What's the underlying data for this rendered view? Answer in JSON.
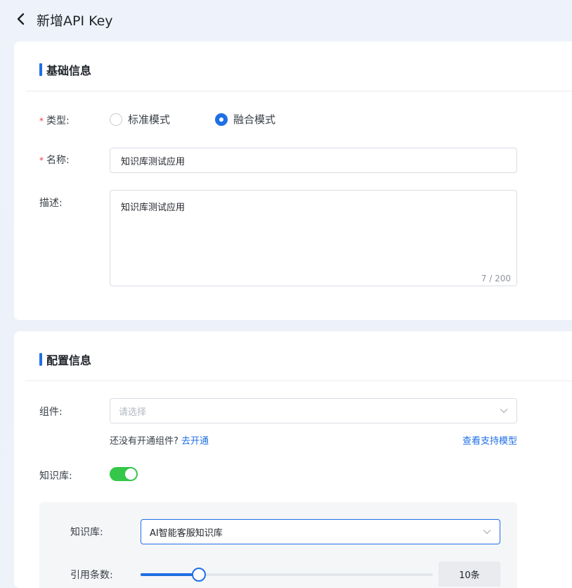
{
  "header": {
    "title": "新增API Key"
  },
  "basic": {
    "section_title": "基础信息",
    "type_label": "类型:",
    "type_options": [
      {
        "label": "标准模式",
        "checked": false
      },
      {
        "label": "融合模式",
        "checked": true
      }
    ],
    "name_label": "名称:",
    "name_value": "知识库测试应用",
    "desc_label": "描述:",
    "desc_value": "知识库测试应用",
    "desc_counter": "7 / 200"
  },
  "config": {
    "section_title": "配置信息",
    "component_label": "组件:",
    "component_placeholder": "请选择",
    "hint_text": "还没有开通组件?",
    "hint_link": "去开通",
    "support_link": "查看支持模型",
    "kb_toggle_label": "知识库:",
    "kb_toggle_on": true,
    "kb_panel": {
      "kb_label": "知识库:",
      "kb_value": "AI智能客服知识库",
      "cite_label": "引用条数:",
      "cite_fraction": 0.2,
      "cite_value": "10条"
    }
  },
  "colors": {
    "accent": "#1f6fe5",
    "toggle_on": "#34c74a",
    "required": "#f03c3c"
  }
}
